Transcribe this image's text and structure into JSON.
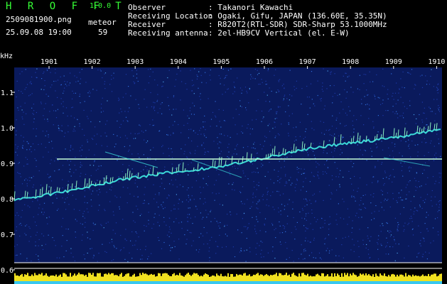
{
  "app": {
    "name": "H R O F F T",
    "version": "1.0.0"
  },
  "file": {
    "name": "2509081900.png",
    "datetime": "25.09.08 19:00"
  },
  "meteor": {
    "label": "meteor",
    "count": "59"
  },
  "info": [
    {
      "key": "Observer",
      "value": ": Takanori Kawachi"
    },
    {
      "key": "Receiving Location",
      "value": ": Ogaki, Gifu, JAPAN (136.60E, 35.35N)"
    },
    {
      "key": "Receiver",
      "value": ": R820T2(RTL-SDR) SDR-Sharp 53.1000MHz"
    },
    {
      "key": "Receiving antenna",
      "value": ": 2el-HB9CV Vertical (el. E-W)"
    }
  ],
  "axis": {
    "unit": "kHz",
    "x_ticks": [
      "1901",
      "1902",
      "1903",
      "1904",
      "1905",
      "1906",
      "1907",
      "1908",
      "1909",
      "1910"
    ],
    "y_ticks": [
      "1.1",
      "1.0",
      "0.9",
      "0.8",
      "0.7",
      "0.6"
    ]
  },
  "colors": {
    "background": "#000000",
    "spectrum": "#0a1a5c",
    "text": "#ffffff",
    "logo": "#36ff36",
    "bars": "#f0e020",
    "bars_base": "#38c8f0"
  }
}
